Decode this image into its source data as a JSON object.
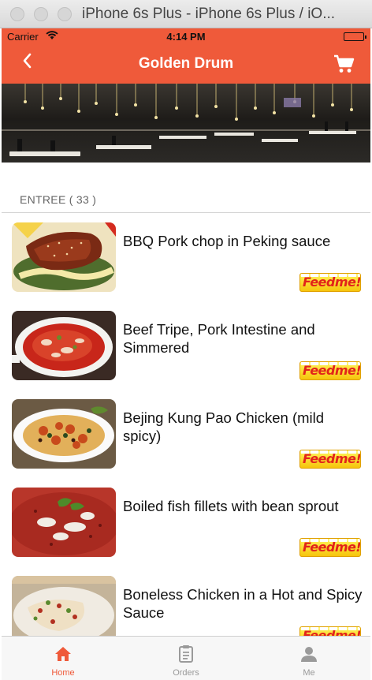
{
  "window": {
    "title": "iPhone 6s Plus - iPhone 6s Plus / iO..."
  },
  "status_bar": {
    "carrier": "Carrier",
    "time": "4:14 PM"
  },
  "nav": {
    "back_icon": "chevron-left-icon",
    "title": "Golden Drum",
    "cart_icon": "shopping-cart-icon"
  },
  "section": {
    "label": "ENTREE ( 33 )"
  },
  "items": [
    {
      "title": "BBQ Pork chop in Peking sauce",
      "badge": "Feedme!"
    },
    {
      "title": "Beef Tripe, Pork Intestine and Simmered",
      "badge": "Feedme!"
    },
    {
      "title": "Bejing Kung Pao Chicken (mild spicy)",
      "badge": "Feedme!"
    },
    {
      "title": "Boiled fish fillets with bean sprout",
      "badge": "Feedme!"
    },
    {
      "title": "Boneless Chicken in a Hot and Spicy Sauce",
      "badge": "Feedme!"
    }
  ],
  "tabs": [
    {
      "label": "Home",
      "icon": "home-icon",
      "active": true
    },
    {
      "label": "Orders",
      "icon": "clipboard-icon",
      "active": false
    },
    {
      "label": "Me",
      "icon": "person-icon",
      "active": false
    }
  ],
  "colors": {
    "accent": "#ef5a3a",
    "badge_yellow": "#f6c40c",
    "badge_text": "#e2231a"
  }
}
